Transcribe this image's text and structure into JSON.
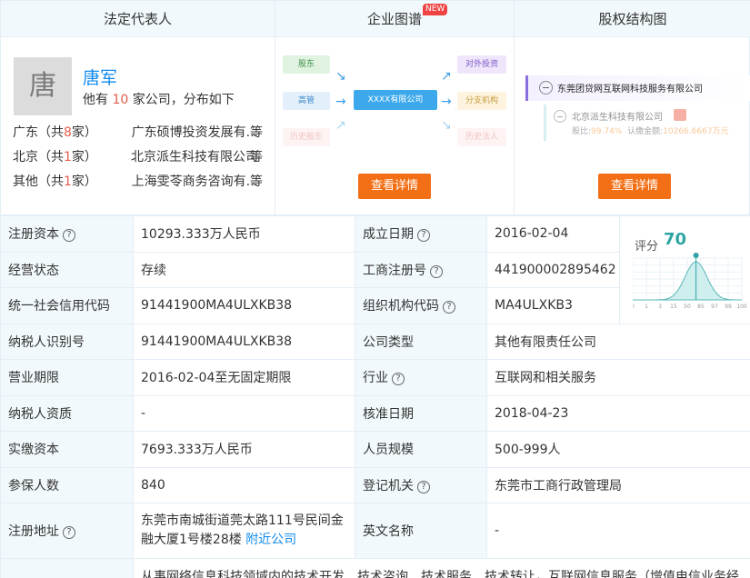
{
  "header": {
    "col1_title": "法定代表人",
    "col2_title": "企业图谱",
    "col2_badge": "NEW",
    "col3_title": "股权结构图"
  },
  "rep": {
    "avatar_char": "唐",
    "name": "唐军",
    "count_prefix": "他有",
    "count": "10",
    "count_suffix": "家公司，分布如下",
    "distribution": [
      {
        "region": "广东（共",
        "n": "8",
        "unit": "家）",
        "company": "广东硕博投资发展有...",
        "suffix": "等"
      },
      {
        "region": "北京（共",
        "n": "1",
        "unit": "家）",
        "company": "北京派生科技有限公司",
        "suffix": "等"
      },
      {
        "region": "其他（共",
        "n": "1",
        "unit": "家）",
        "company": "上海雯苓商务咨询有...",
        "suffix": "等"
      }
    ]
  },
  "graph": {
    "nodes": {
      "shareholder": "股东",
      "executive": "高管",
      "legal_history": "历史股东",
      "center": "XXXX有限公司",
      "investment": "对外投资",
      "branch": "分支机构",
      "history_legal": "历史法人"
    },
    "button": "查看详情"
  },
  "equity": {
    "root": "东莞团贷网互联网科技服务有限公司",
    "child_name": "北京派生科技有限公司",
    "child_ratio_label": "股比:",
    "child_ratio": "99.74%",
    "child_amount_label": "认缴金额:",
    "child_amount": "10266.6667万元",
    "button": "查看详情"
  },
  "info": {
    "reg_capital_label": "注册资本",
    "reg_capital": "10293.333万人民币",
    "found_date_label": "成立日期",
    "found_date": "2016-02-04",
    "score_label": "评分",
    "score": "70",
    "score_ticks": [
      "0",
      "1",
      "3",
      "15",
      "50",
      "85",
      "97",
      "99",
      "100"
    ],
    "status_label": "经营状态",
    "status": "存续",
    "biz_reg_no_label": "工商注册号",
    "biz_reg_no": "441900002895462",
    "credit_code_label": "统一社会信用代码",
    "credit_code": "91441900MA4ULXKB38",
    "org_code_label": "组织机构代码",
    "org_code": "MA4ULXKB3",
    "taxpayer_id_label": "纳税人识别号",
    "taxpayer_id": "91441900MA4ULXKB38",
    "company_type_label": "公司类型",
    "company_type": "其他有限责任公司",
    "term_label": "营业期限",
    "term": "2016-02-04至无固定期限",
    "industry_label": "行业",
    "industry": "互联网和相关服务",
    "taxpayer_qual_label": "纳税人资质",
    "taxpayer_qual": "-",
    "approve_date_label": "核准日期",
    "approve_date": "2018-04-23",
    "paid_capital_label": "实缴资本",
    "paid_capital": "7693.333万人民币",
    "staff_label": "人员规模",
    "staff": "500-999人",
    "insured_label": "参保人数",
    "insured": "840",
    "authority_label": "登记机关",
    "authority": "东莞市工商行政管理局",
    "address_label": "注册地址",
    "address": "东莞市南城街道莞太路111号民间金融大厦1号楼28楼",
    "nearby_link": "附近公司",
    "en_name_label": "英文名称",
    "en_name": "-",
    "scope_partial": "从事网络信息科技领域内的技术开发、技术咨询、技术服务、技术转让，互联网信息服务（增值电信业务经"
  },
  "colors": {
    "accent": "#128bed",
    "orange": "#f36f16",
    "header_bg": "#f2f9fc",
    "score_teal": "#2fa4a4"
  }
}
